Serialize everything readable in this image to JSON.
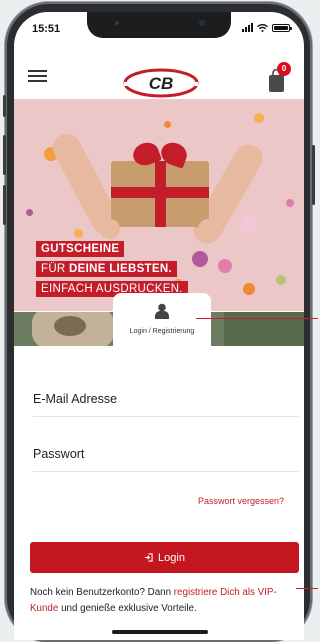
{
  "status_bar": {
    "time": "15:51"
  },
  "header": {
    "logo_text": "CB",
    "cart_badge": "0"
  },
  "hero": {
    "promo_line1": "GUTSCHEINE",
    "promo_line2_light": "FÜR",
    "promo_line2_bold": "DEINE LIEBSTEN.",
    "promo_line3": "EINFACH AUSDRUCKEN."
  },
  "login_tab": {
    "label": "Login / Registrierung"
  },
  "form": {
    "email_placeholder": "E-Mail Adresse",
    "password_placeholder": "Passwort",
    "forgot_password": "Passwort vergessen?",
    "login_button": "Login"
  },
  "register": {
    "text_before": "Noch kein Benutzerkonto? Dann",
    "link_text": "registriere Dich als VIP-Kunde",
    "text_after": "und genieße exklusive Vorteile."
  },
  "colors": {
    "brand_red": "#c31d2a",
    "hero_bg": "#ecc7c8"
  },
  "icons": [
    "hamburger-icon",
    "cart-icon",
    "user-icon",
    "login-icon",
    "signal-icon",
    "wifi-icon",
    "battery-icon"
  ]
}
